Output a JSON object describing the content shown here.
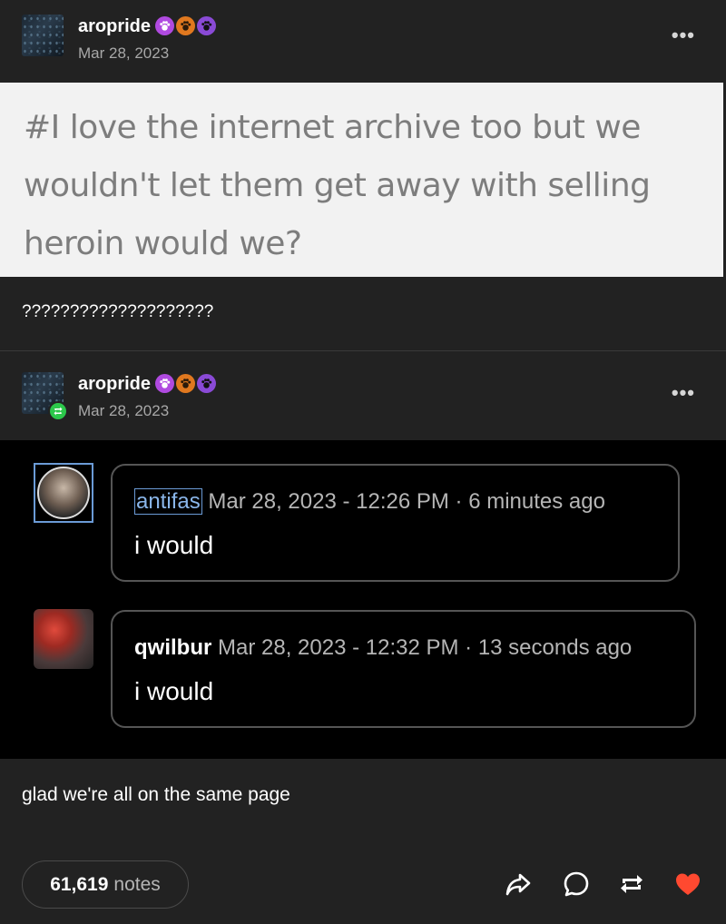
{
  "posts": [
    {
      "blog_name": "aropride",
      "date": "Mar 28, 2023",
      "quote_image_text": "#I love the internet archive too but we wouldn't let them get away with selling heroin would we?",
      "body_text": "????????????????????"
    },
    {
      "blog_name": "aropride",
      "date": "Mar 28, 2023",
      "reblog": true,
      "chat": [
        {
          "author": "antifas",
          "timestamp": "Mar 28, 2023 - 12:26 PM",
          "relative": "6 minutes ago",
          "message": "i would"
        },
        {
          "author": "qwilbur",
          "timestamp": "Mar 28, 2023 - 12:32 PM",
          "relative": "13 seconds ago",
          "message": "i would"
        }
      ],
      "body_text": "glad we're all on the same page"
    }
  ],
  "footer": {
    "notes_count": "61,619",
    "notes_label": "notes"
  },
  "icons": {
    "more": "more-dots-icon",
    "share": "share-icon",
    "reply": "reply-icon",
    "reblog": "reblog-icon",
    "like": "heart-icon"
  },
  "colors": {
    "background": "#222222",
    "like": "#ff4930",
    "reblog_badge": "#2cc84b"
  },
  "separator": " · "
}
